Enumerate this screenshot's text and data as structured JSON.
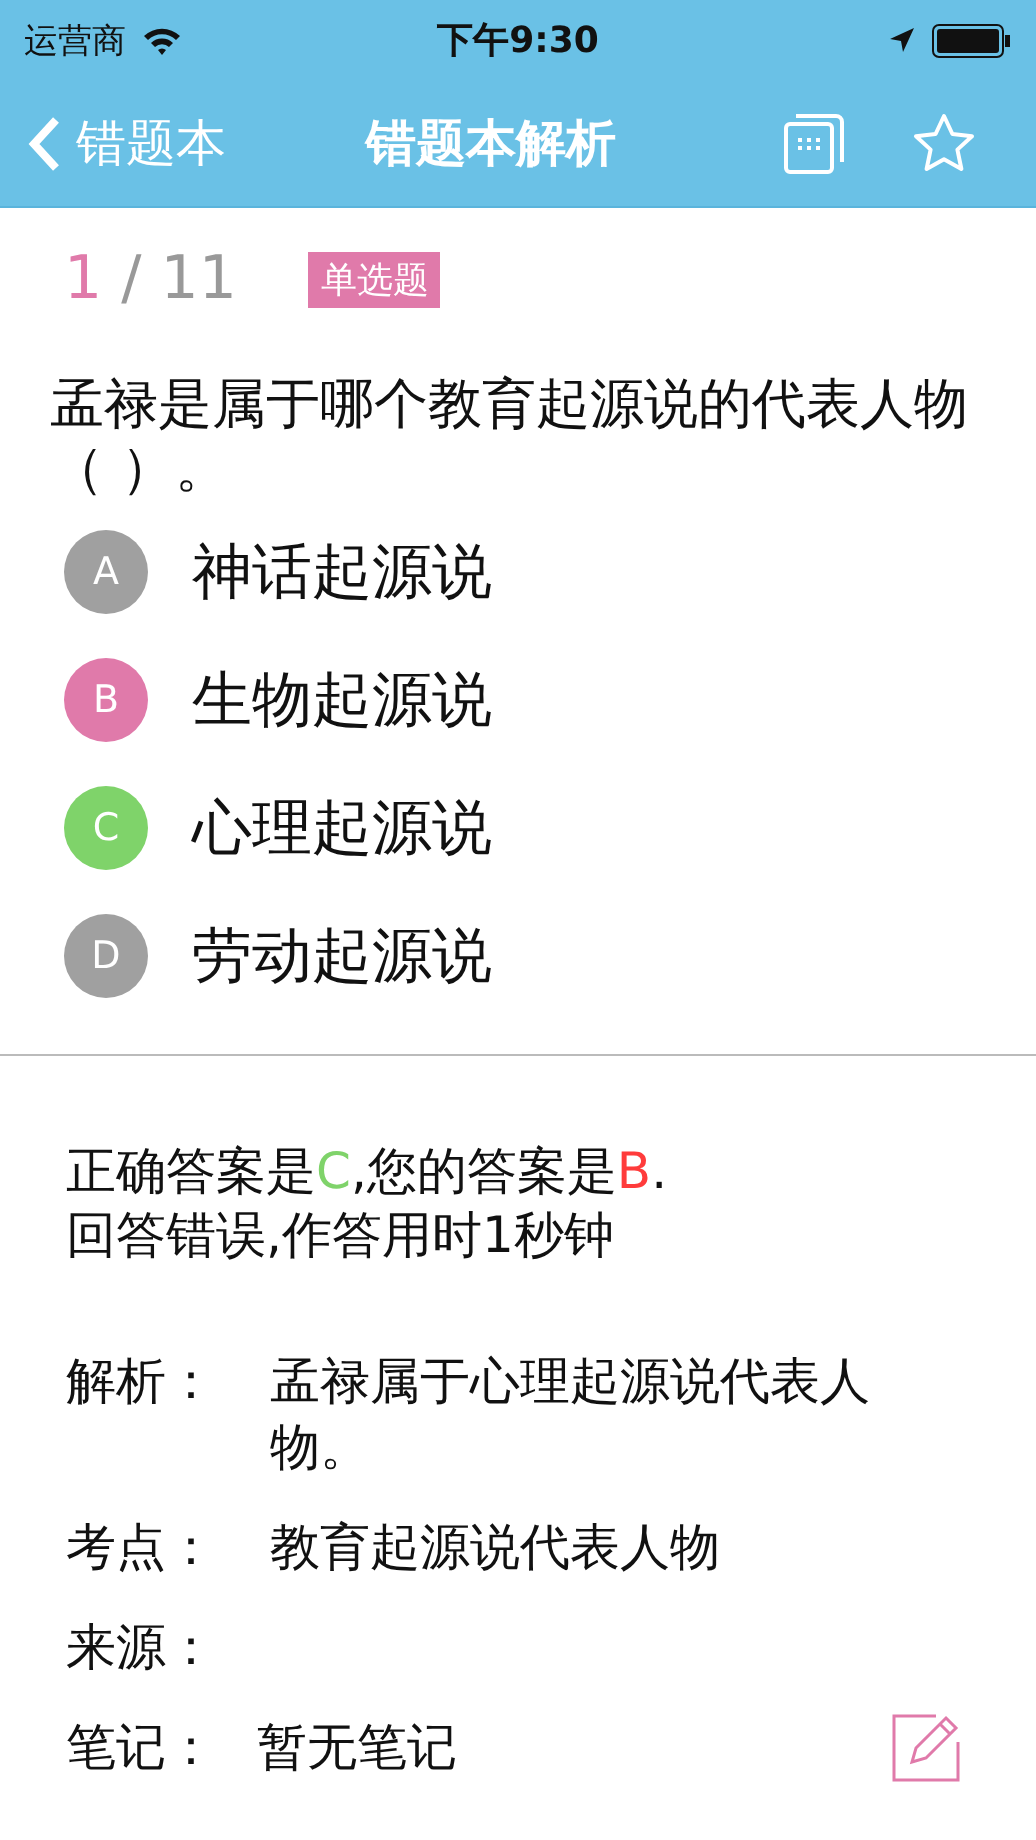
{
  "status_bar": {
    "carrier": "运营商",
    "time": "下午9:30"
  },
  "nav": {
    "back": "错题本",
    "title": "错题本解析"
  },
  "question": {
    "index": "1",
    "separator": "/",
    "total": "11",
    "type": "单选题",
    "text": "孟禄是属于哪个教育起源说的代表人物（ ）。",
    "options": [
      {
        "letter": "A",
        "text": "神话起源说",
        "color": "#a0a0a0"
      },
      {
        "letter": "B",
        "text": "生物起源说",
        "color": "#e07aaa"
      },
      {
        "letter": "C",
        "text": "心理起源说",
        "color": "#7fd36a"
      },
      {
        "letter": "D",
        "text": "劳动起源说",
        "color": "#a0a0a0"
      }
    ]
  },
  "result": {
    "prefix": "正确答案是",
    "correct": "C",
    "middle": ",您的答案是",
    "yours": "B",
    "suffix": ".",
    "summary": "回答错误,作答用时1秒钟"
  },
  "details": [
    {
      "label": "解析：",
      "value": "孟禄属于心理起源说代表人物。"
    },
    {
      "label": "考点：",
      "value": "教育起源说代表人物"
    },
    {
      "label": "来源："
    },
    {
      "label": "笔记：",
      "value": "暂无笔记",
      "editable": true
    }
  ]
}
